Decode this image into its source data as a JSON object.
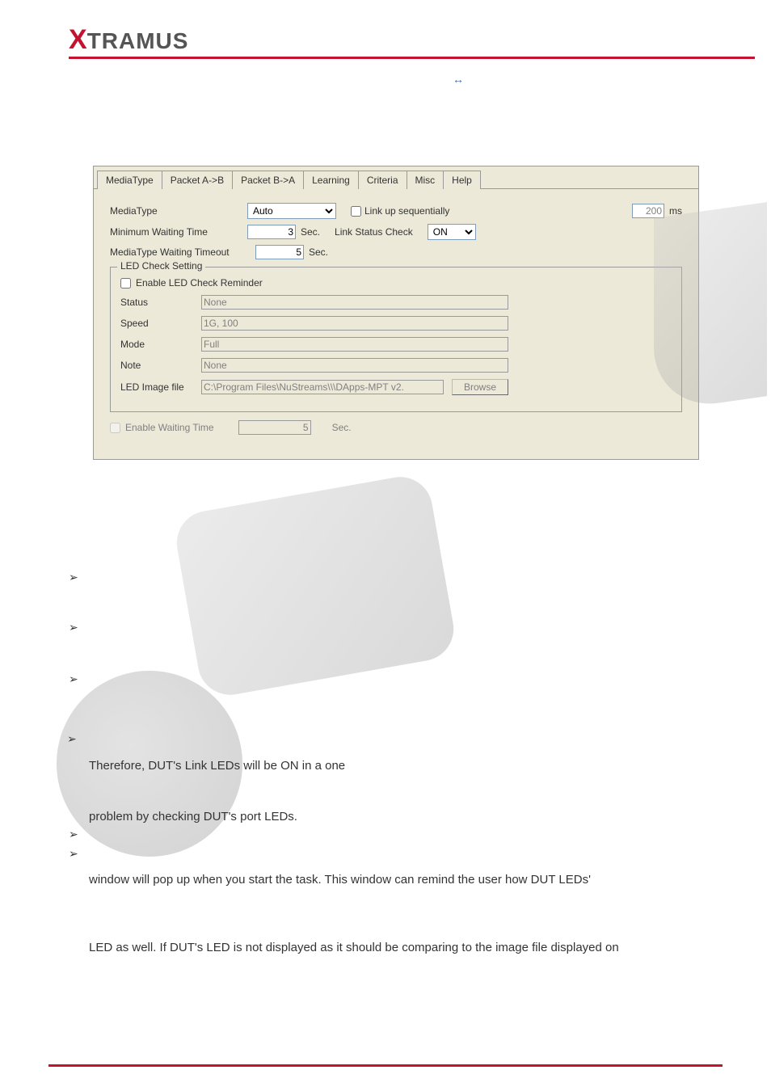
{
  "logo": {
    "x": "X",
    "rest": "TRAMUS"
  },
  "arrow_symbol": "↔",
  "tabs": {
    "media": "MediaType",
    "pab": "Packet A->B",
    "pba": "Packet B->A",
    "learning": "Learning",
    "criteria": "Criteria",
    "misc": "Misc",
    "help": "Help"
  },
  "form": {
    "media_type_label": "MediaType",
    "media_type_value": "Auto",
    "link_up_seq_label": "Link up sequentially",
    "ms_value": "200",
    "ms_unit": "ms",
    "min_wait_label": "Minimum Waiting Time",
    "min_wait_value": "3",
    "sec_unit": "Sec.",
    "link_status_label": "Link Status Check",
    "link_status_value": "ON",
    "mt_timeout_label": "MediaType Waiting Timeout",
    "mt_timeout_value": "5"
  },
  "led": {
    "group_title": "LED Check Setting",
    "enable_label": "Enable LED Check Reminder",
    "status_label": "Status",
    "status_value": "None",
    "speed_label": "Speed",
    "speed_value": "1G, 100",
    "mode_label": "Mode",
    "mode_value": "Full",
    "note_label": "Note",
    "note_value": "None",
    "image_label": "LED Image file",
    "image_value": "C:\\Program Files\\NuStreams\\\\\\DApps-MPT v2.",
    "browse": "Browse"
  },
  "ewt": {
    "label": "Enable Waiting Time",
    "value": "5",
    "unit": "Sec."
  },
  "body": {
    "line1": "Therefore, DUT's Link LEDs will be ON in a one",
    "line2": "problem by checking DUT's port LEDs.",
    "line3": "window will pop up when you start the task. This window can remind the user how DUT LEDs'",
    "line4": "LED as well. If DUT's LED is not displayed as it should be comparing to the image file displayed on"
  },
  "bullet": "➢"
}
